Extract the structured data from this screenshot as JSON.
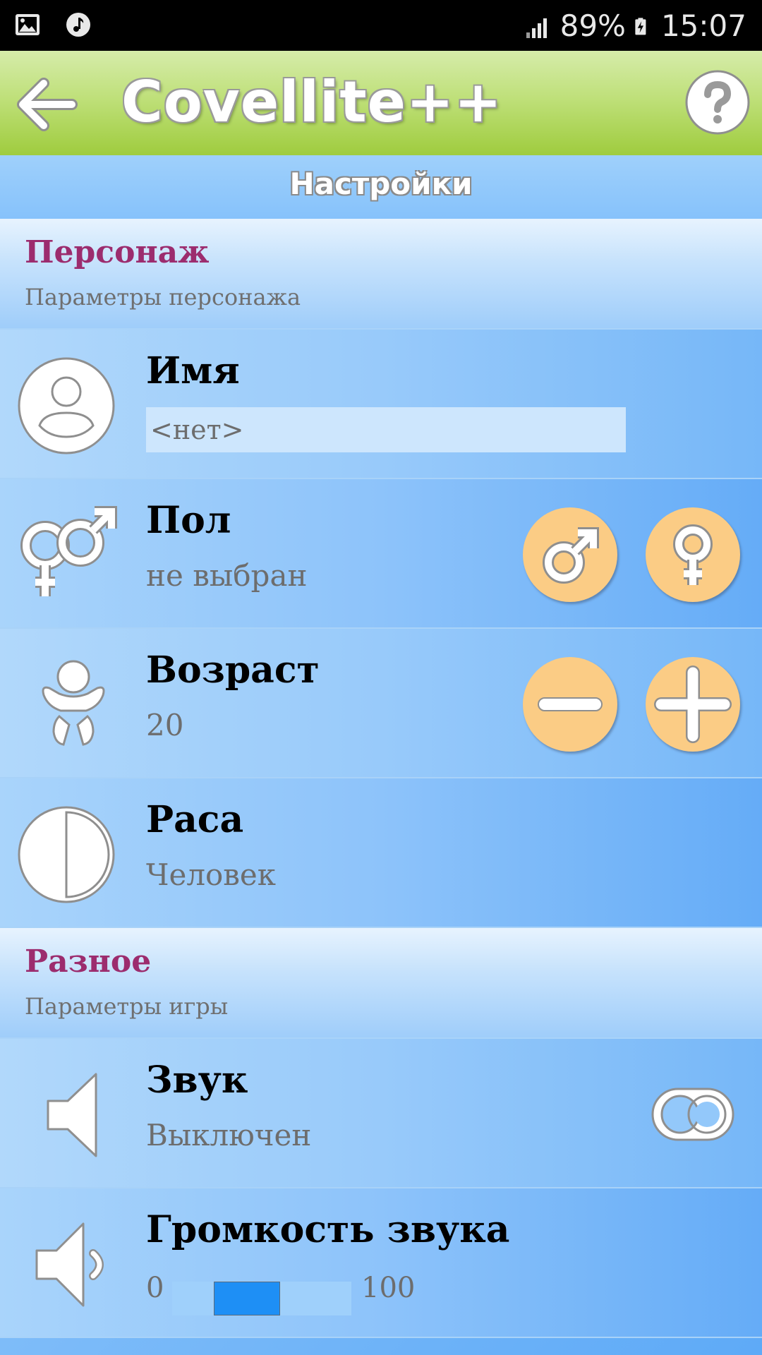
{
  "status_bar": {
    "battery": "89%",
    "time": "15:07",
    "icons": [
      "image-notification-icon",
      "music-notification-icon",
      "signal-icon",
      "battery-charging-icon"
    ]
  },
  "app_bar": {
    "title": "Covellite++",
    "back_icon": "arrow-left-icon",
    "help_icon": "question-circle-icon"
  },
  "page": {
    "title": "Настройки"
  },
  "section_character": {
    "title": "Персонаж",
    "subtitle": "Параметры персонажа"
  },
  "name": {
    "label": "Имя",
    "value": "<нет>"
  },
  "gender": {
    "label": "Пол",
    "value": "не выбран",
    "male_icon": "male-symbol-icon",
    "female_icon": "female-symbol-icon"
  },
  "age": {
    "label": "Возраст",
    "value": "20",
    "minus_icon": "minus-icon",
    "plus_icon": "plus-icon"
  },
  "race": {
    "label": "Раса",
    "value": "Человек"
  },
  "section_misc": {
    "title": "Разное",
    "subtitle": "Параметры игры"
  },
  "sound": {
    "label": "Звук",
    "value": "Выключен",
    "enabled": false
  },
  "volume": {
    "label": "Громкость звука",
    "min": "0",
    "max": "100",
    "level_fraction": 0.37
  },
  "colors": {
    "accent_green": "#9fcc3e",
    "section_title": "#9c2c6e",
    "button_orange": "#fbcc85",
    "slider_thumb": "#1e8ff5"
  }
}
